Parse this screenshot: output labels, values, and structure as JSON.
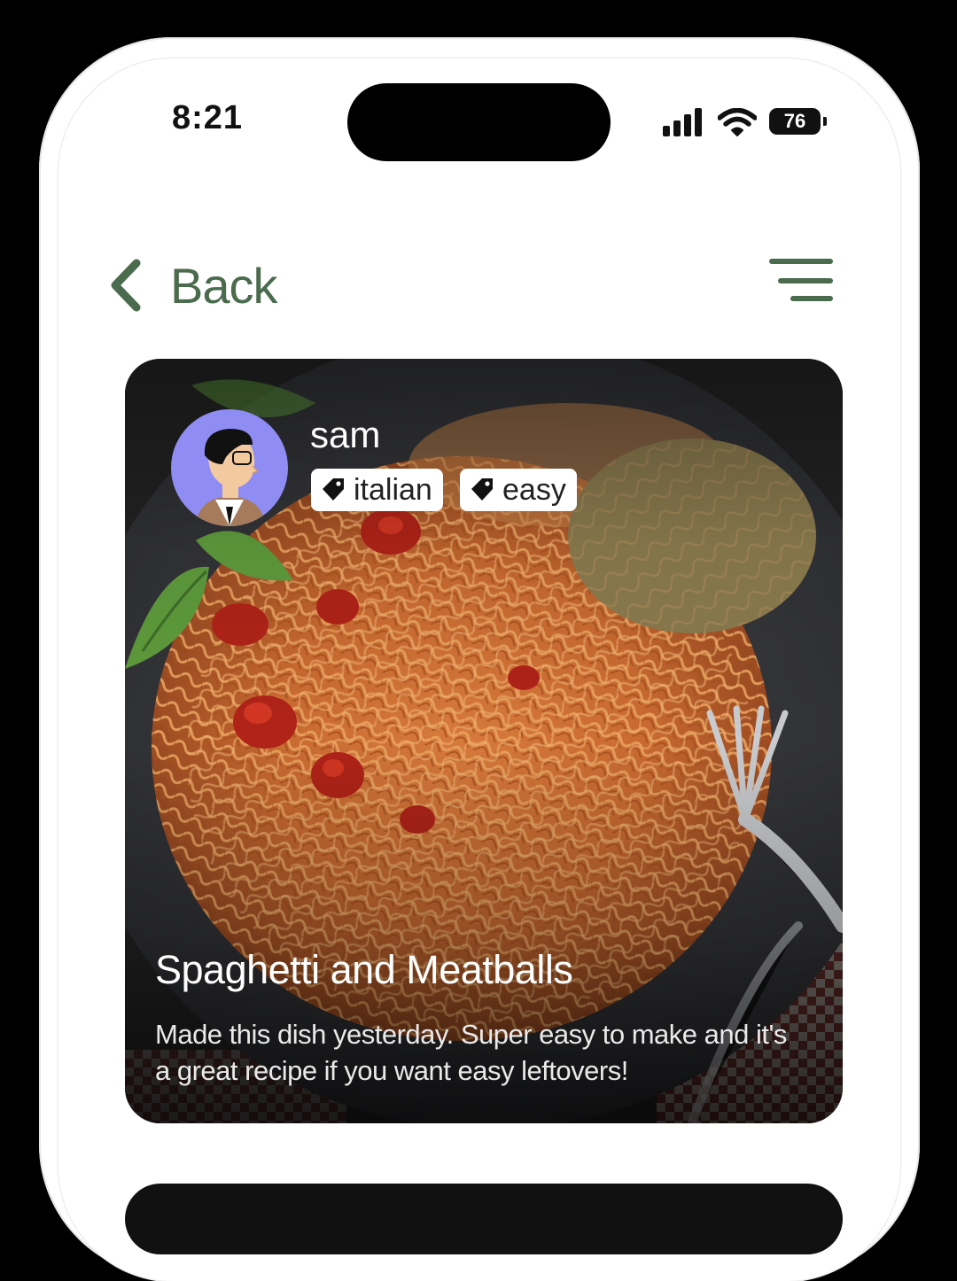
{
  "status_bar": {
    "time": "8:21",
    "battery": "76"
  },
  "nav": {
    "back_label": "Back"
  },
  "post": {
    "username": "sam",
    "tags": [
      "italian",
      "easy"
    ],
    "title": "Spaghetti and Meatballs",
    "description": "Made this dish yesterday. Super easy to make and it's a great recipe if you want easy leftovers!"
  },
  "icons": {
    "back": "chevron-left-icon",
    "menu": "hamburger-menu-icon",
    "tag": "tag-icon",
    "signal": "cellular-signal-icon",
    "wifi": "wifi-icon",
    "battery": "battery-icon"
  },
  "colors": {
    "accent": "#4a6b4e",
    "avatar_bg": "#8f8cf3"
  }
}
